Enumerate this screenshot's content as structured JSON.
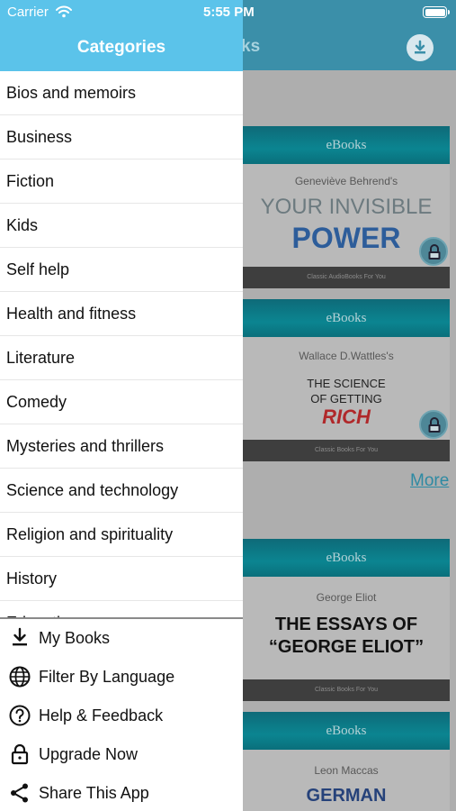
{
  "status_bar": {
    "carrier": "Carrier",
    "time": "5:55 PM"
  },
  "background": {
    "title_fragment": "ks",
    "books": [
      {
        "brand": "eBooks",
        "author": "Geneviève Behrend's",
        "title_line1": "YOUR INVISIBLE",
        "title_line2": "POWER",
        "footer": "Classic AudioBooks For You",
        "locked": true
      },
      {
        "brand": "eBooks",
        "author": "Wallace D.Wattles's",
        "title_line1": "THE SCIENCE",
        "title_line2": "OF GETTING",
        "title_line3": "RICH",
        "footer": "Classic Books For You",
        "locked": true
      },
      {
        "brand": "eBooks",
        "author": "George Eliot",
        "title_line1": "THE ESSAYS OF",
        "title_line2": "“GEORGE ELIOT”",
        "footer": "Classic Books For You"
      },
      {
        "brand": "eBooks",
        "author": "Leon Maccas",
        "title_line1": "GERMAN"
      }
    ],
    "more_label": "More"
  },
  "drawer": {
    "title": "Categories",
    "categories": [
      "Bios and memoirs",
      "Business",
      "Fiction",
      "Kids",
      "Self help",
      "Health and fitness",
      "Literature",
      "Comedy",
      "Mysteries and thrillers",
      "Science and technology",
      "Religion and spirituality",
      "History",
      "Education"
    ],
    "menu": [
      {
        "label": "My Books",
        "icon": "download-icon"
      },
      {
        "label": "Filter By Language",
        "icon": "globe-icon"
      },
      {
        "label": "Help & Feedback",
        "icon": "help-icon"
      },
      {
        "label": "Upgrade Now",
        "icon": "lock-icon"
      },
      {
        "label": "Share This App",
        "icon": "share-icon"
      }
    ]
  },
  "colors": {
    "drawer_header": "#5bc3ea",
    "app_header_dimmed": "#3b8fa9",
    "link": "#2e8aa3"
  }
}
